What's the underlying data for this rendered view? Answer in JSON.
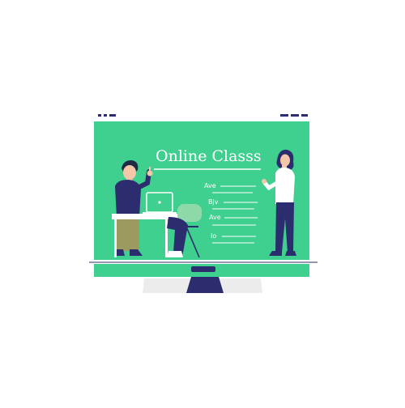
{
  "illustration": {
    "title": "Online Classs",
    "board_lines": [
      "Ave",
      "Bjv",
      "Ave",
      "Io"
    ],
    "colors": {
      "screen": "#3fcf8e",
      "frame": "#ffffff",
      "stand": "#2b2d6e",
      "base": "#ececec",
      "shirt_dark": "#2b2d6e",
      "pants_olive": "#9c9a5e",
      "hair": "#1f2a44",
      "skin": "#f4c7a9"
    }
  }
}
